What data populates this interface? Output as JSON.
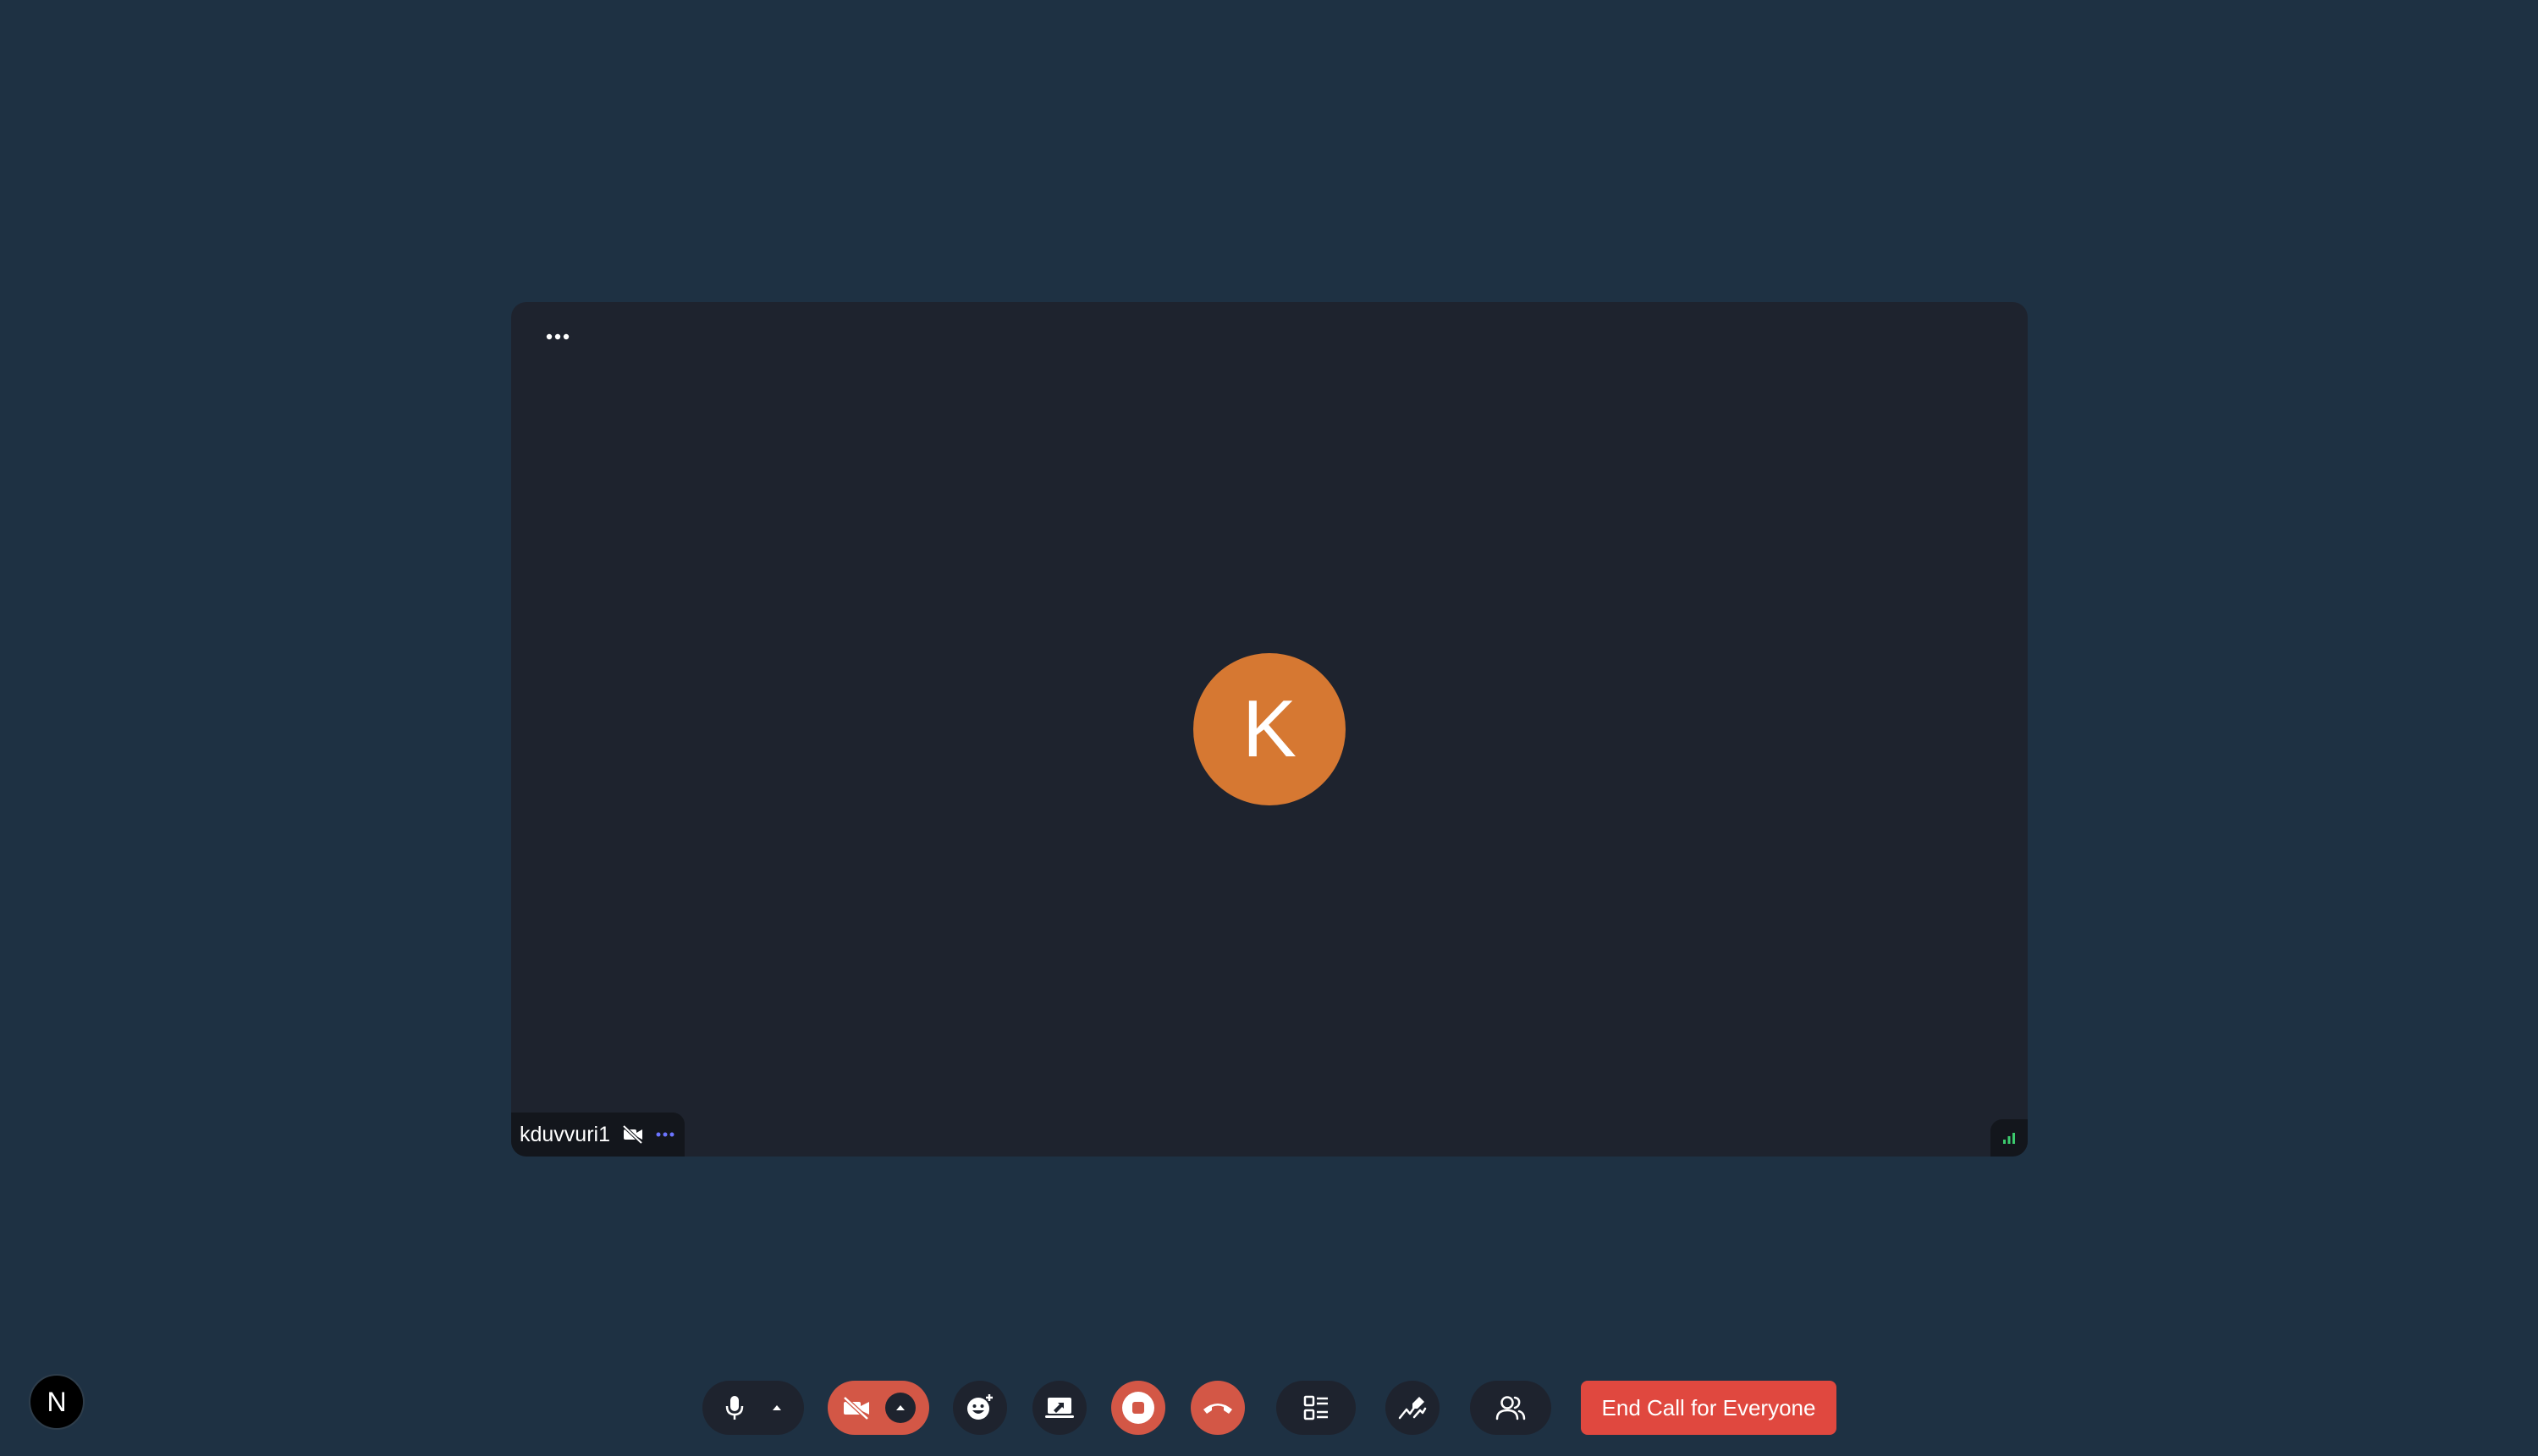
{
  "tile": {
    "participant_name": "kduvvuri1",
    "avatar_initial": "K",
    "avatar_color": "#d67832",
    "menu_icon": "more-horizontal-icon",
    "camera_status_icon": "video-off-icon",
    "options_icon": "more-horizontal-icon",
    "signal_icon": "signal-strength-icon"
  },
  "logo": {
    "letter": "N"
  },
  "toolbar": {
    "mic_icon": "microphone-icon",
    "camera_icon": "video-off-icon",
    "reaction_icon": "emoji-add-icon",
    "share_icon": "screen-share-icon",
    "record_icon": "stop-record-icon",
    "hangup_icon": "phone-hangup-icon",
    "layout_icon": "layout-list-icon",
    "whiteboard_icon": "whiteboard-icon",
    "people_icon": "participants-icon",
    "end_all_label": "End Call for Everyone"
  },
  "colors": {
    "background": "#1e3143",
    "tile": "#1e232e",
    "danger": "#d35746",
    "end_button": "#e0483f"
  }
}
